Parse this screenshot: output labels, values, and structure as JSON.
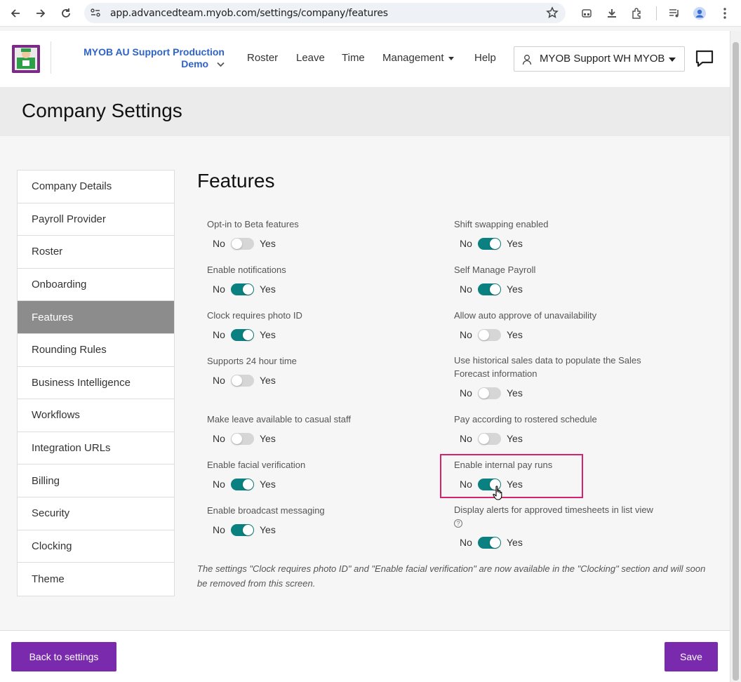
{
  "browser": {
    "url": "app.advancedteam.myob.com/settings/company/features"
  },
  "header": {
    "org_line1": "MYOB AU Support Production",
    "org_line2": "Demo",
    "menu": {
      "roster": "Roster",
      "leave": "Leave",
      "time": "Time",
      "management": "Management",
      "help": "Help"
    },
    "user_name": "MYOB Support WH MYOB"
  },
  "page": {
    "title": "Company Settings"
  },
  "sidenav": {
    "items": [
      {
        "label": "Company Details"
      },
      {
        "label": "Payroll Provider"
      },
      {
        "label": "Roster"
      },
      {
        "label": "Onboarding"
      },
      {
        "label": "Features",
        "active": true
      },
      {
        "label": "Rounding Rules"
      },
      {
        "label": "Business Intelligence"
      },
      {
        "label": "Workflows"
      },
      {
        "label": "Integration URLs"
      },
      {
        "label": "Billing"
      },
      {
        "label": "Security"
      },
      {
        "label": "Clocking"
      },
      {
        "label": "Theme"
      }
    ]
  },
  "features": {
    "title": "Features",
    "no_label": "No",
    "yes_label": "Yes",
    "left": [
      {
        "label": "Opt-in to Beta features",
        "enabled": false
      },
      {
        "label": "Enable notifications",
        "enabled": true
      },
      {
        "label": "Clock requires photo ID",
        "enabled": true
      },
      {
        "label": "Supports 24 hour time",
        "enabled": false
      },
      {
        "label": "Make leave available to casual staff",
        "enabled": false
      },
      {
        "label": "Enable facial verification",
        "enabled": true
      },
      {
        "label": "Enable broadcast messaging",
        "enabled": true
      }
    ],
    "right": [
      {
        "label": "Shift swapping enabled",
        "enabled": true
      },
      {
        "label": "Self Manage Payroll",
        "enabled": true
      },
      {
        "label": "Allow auto approve of unavailability",
        "enabled": false
      },
      {
        "label": "Use historical sales data to populate the Sales Forecast information",
        "enabled": false
      },
      {
        "label": "Pay according to rostered schedule",
        "enabled": false
      },
      {
        "label": "Enable internal pay runs",
        "enabled": true,
        "highlighted": true
      },
      {
        "label": "Display alerts for approved timesheets in list view",
        "enabled": true,
        "help": "?"
      }
    ],
    "note": "The settings \"Clock requires photo ID\" and \"Enable facial verification\" are now available in the \"Clocking\" section and will soon be removed from this screen."
  },
  "footer": {
    "back_label": "Back to settings",
    "save_label": "Save"
  },
  "colors": {
    "accent": "#7a2aad",
    "toggle_on": "#0b8080",
    "toggle_off": "#d6d6d6",
    "org_link": "#2e63c7",
    "highlight": "#d6236e"
  }
}
